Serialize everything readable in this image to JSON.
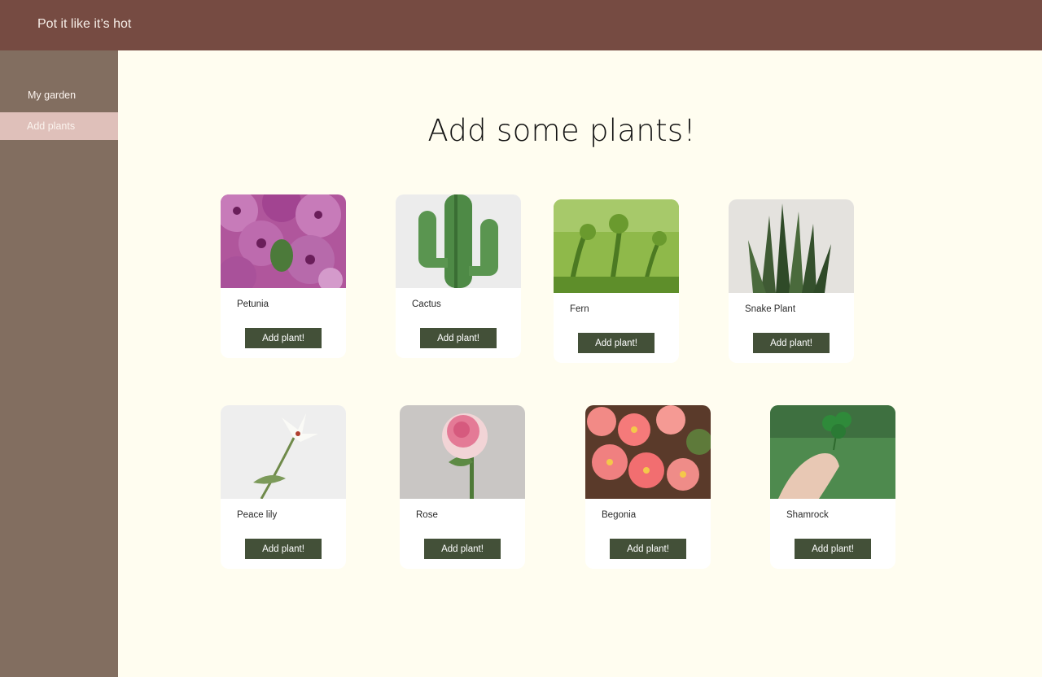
{
  "header": {
    "app_title": "Pot it like it’s hot"
  },
  "sidebar": {
    "items": [
      {
        "label": "My garden",
        "active": false
      },
      {
        "label": "Add plants",
        "active": true
      }
    ]
  },
  "main": {
    "title": "Add some plants!",
    "plants": [
      {
        "name": "Petunia",
        "button_label": "Add plant!",
        "image": "petunia-photo"
      },
      {
        "name": "Cactus",
        "button_label": "Add plant!",
        "image": "cactus-photo"
      },
      {
        "name": "Fern",
        "button_label": "Add plant!",
        "image": "fern-photo"
      },
      {
        "name": "Snake Plant",
        "button_label": "Add plant!",
        "image": "snake-plant-photo"
      },
      {
        "name": "Peace lily",
        "button_label": "Add plant!",
        "image": "peace-lily-photo"
      },
      {
        "name": "Rose",
        "button_label": "Add plant!",
        "image": "rose-photo"
      },
      {
        "name": "Begonia",
        "button_label": "Add plant!",
        "image": "begonia-photo"
      },
      {
        "name": "Shamrock",
        "button_label": "Add plant!",
        "image": "shamrock-photo"
      }
    ]
  },
  "colors": {
    "header": "#764B42",
    "sidebar": "#826E60",
    "sidebar_active": "#DFC0BA",
    "background": "#FFFDF0",
    "button": "#435038"
  }
}
